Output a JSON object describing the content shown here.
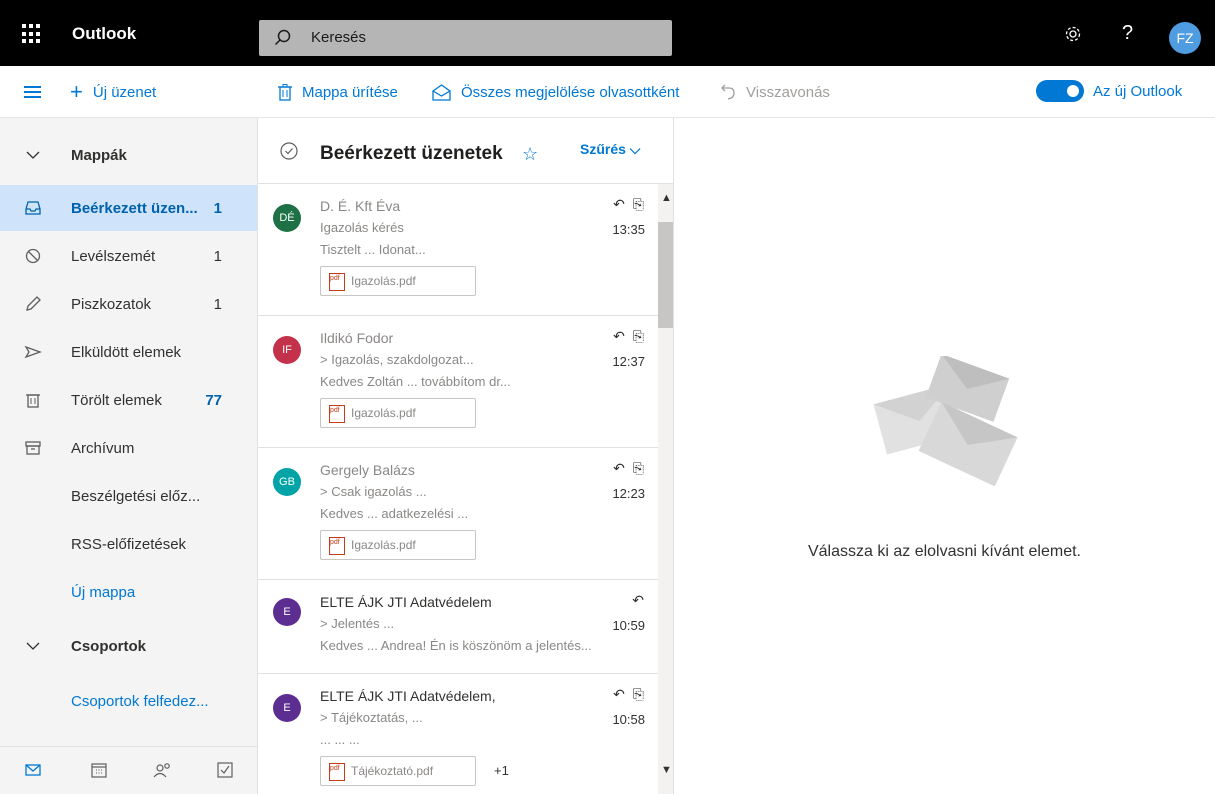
{
  "app": {
    "title": "Outlook",
    "search_placeholder": "Keresés",
    "user_initials": "FZ",
    "help_glyph": "?"
  },
  "colors": {
    "accent": "#0078d4",
    "topbar": "#000000",
    "selected": "#cfe4fa"
  },
  "commands": {
    "new_message": "Új üzenet",
    "empty_folder": "Mappa ürítése",
    "mark_all_read": "Összes megjelölése olvasottként",
    "undo": "Visszavonás",
    "new_outlook": "Az új Outlook"
  },
  "nav": {
    "folders_header": "Mappák",
    "items": [
      {
        "label": "Beérkezett üzen...",
        "count": "1",
        "icon": "inbox-icon"
      },
      {
        "label": "Levélszemét",
        "count": "1",
        "icon": "junk-icon"
      },
      {
        "label": "Piszkozatok",
        "count": "1",
        "icon": "drafts-icon"
      },
      {
        "label": "Elküldött elemek",
        "count": "",
        "icon": "sent-icon"
      },
      {
        "label": "Törölt elemek",
        "count": "77",
        "icon": "trash-icon"
      },
      {
        "label": "Archívum",
        "count": "",
        "icon": "archive-icon"
      },
      {
        "label": "Beszélgetési előz...",
        "count": ""
      },
      {
        "label": "RSS-előfizetések",
        "count": ""
      }
    ],
    "new_folder": "Új mappa",
    "groups_header": "Csoportok",
    "discover_groups": "Csoportok felfedez..."
  },
  "list": {
    "title": "Beérkezett üzenetek",
    "filter": "Szűrés",
    "messages": [
      {
        "initials": "DÉ",
        "color": "#1e7145",
        "sender": "D. É. Kft Éva",
        "subject": "Igazolás kérés",
        "time": "13:35",
        "preview": "Tisztelt ... Idonat...",
        "attachment": "Igazolás.pdf",
        "extra": ""
      },
      {
        "initials": "IF",
        "color": "#c4314b",
        "sender": "Ildikó Fodor",
        "subject": "> Igazolás, szakdolgozat...",
        "time": "12:37",
        "preview": "Kedves Zoltán ... továbbítom dr...",
        "attachment": "Igazolás.pdf",
        "extra": ""
      },
      {
        "initials": "GB",
        "color": "#00a4a6",
        "sender": "Gergely Balázs",
        "subject": "> Csak igazolás ...",
        "time": "12:23",
        "preview": "Kedves ... adatkezelési ...",
        "attachment": "Igazolás.pdf",
        "extra": ""
      },
      {
        "initials": "E",
        "color": "#5c2e91",
        "sender": "ELTE ÁJK JTI Adatvédelem",
        "subject": "> Jelentés ...",
        "time": "10:59",
        "preview": "Kedves ... Andrea! Én is köszönöm a jelentés...",
        "attachment": "",
        "extra": ""
      },
      {
        "initials": "E",
        "color": "#5c2e91",
        "sender": "ELTE ÁJK JTI Adatvédelem,",
        "subject": "> Tájékoztatás, ...",
        "time": "10:58",
        "preview": "... ... ...",
        "attachment": "Tájékoztató.pdf",
        "extra": "+1"
      }
    ]
  },
  "reading": {
    "empty_text": "Válassza ki az elolvasni kívánt elemet."
  }
}
